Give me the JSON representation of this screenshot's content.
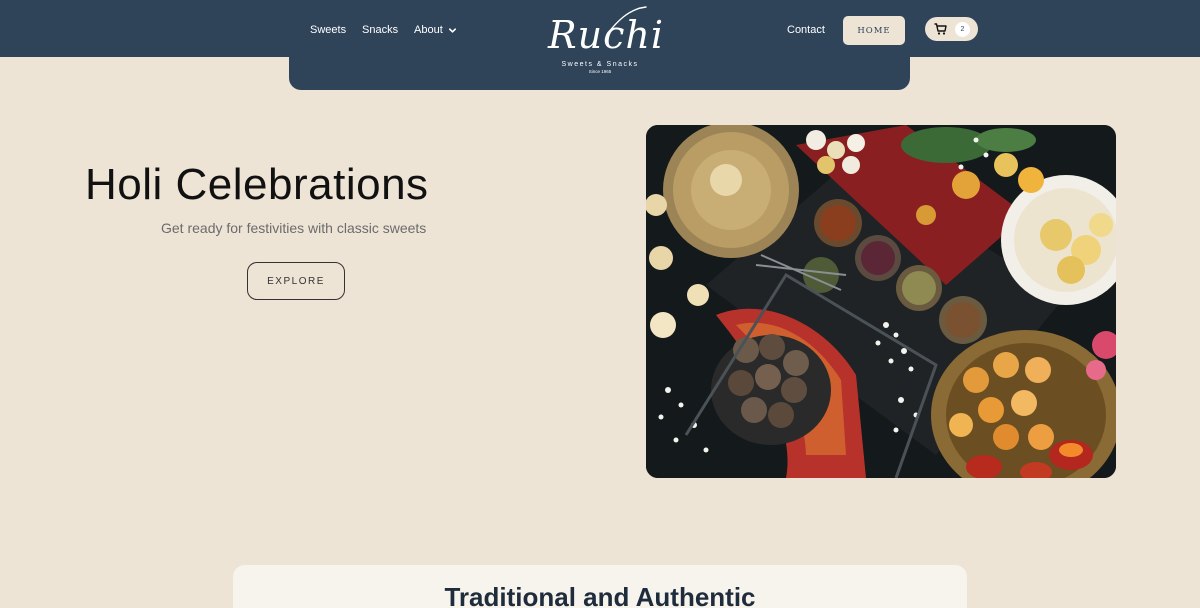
{
  "nav": {
    "sweets": "Sweets",
    "snacks": "Snacks",
    "about": "About",
    "contact": "Contact",
    "home_button": "HOME",
    "cart_count": "2"
  },
  "logo": {
    "name": "Ruchi",
    "tagline": "Sweets & Snacks",
    "since": "Since 1965"
  },
  "hero": {
    "title": "Holi Celebrations",
    "subtitle": "Get ready for festivities with classic sweets",
    "cta": "EXPLORE"
  },
  "section": {
    "title": "Traditional and Authentic"
  },
  "colors": {
    "background": "#ede4d6",
    "header": "#2f4359",
    "heading": "#1e2c3b"
  },
  "icons": {
    "cart": "cart-icon",
    "about_dropdown": "chevron-down-icon"
  }
}
